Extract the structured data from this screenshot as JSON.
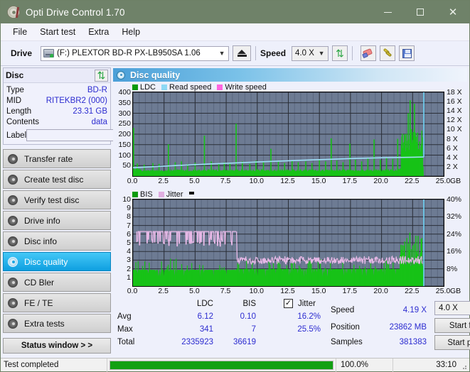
{
  "titlebar": {
    "title": "Opti Drive Control 1.70",
    "minimize": "–",
    "maximize": "",
    "close": "✕",
    "icon": "disc-icon"
  },
  "menubar": {
    "items": [
      {
        "label": "File"
      },
      {
        "label": "Start test"
      },
      {
        "label": "Extra"
      },
      {
        "label": "Help"
      }
    ]
  },
  "toolbar": {
    "drive_label": "Drive",
    "drive_value": "(F:)  PLEXTOR BD-R  PX-LB950SA 1.06",
    "eject_icon": "eject-icon",
    "speed_label": "Speed",
    "speed_value": "4.0 X",
    "refresh_icon": "refresh-icon",
    "erase_icon": "eraser-icon",
    "tools_icon": "tools-icon",
    "save_icon": "save-icon"
  },
  "sidebar": {
    "disc": {
      "title": "Disc",
      "refresh_icon": "refresh-icon",
      "rows": [
        {
          "key": "Type",
          "value": "BD-R"
        },
        {
          "key": "MID",
          "value": "RITEKBR2 (000)"
        },
        {
          "key": "Length",
          "value": "23.31 GB"
        },
        {
          "key": "Contents",
          "value": "data"
        }
      ],
      "label_key": "Label",
      "label_value": "",
      "label_placeholder": "",
      "disc_icon": "cd-icon"
    },
    "nav": [
      {
        "label": "Transfer rate",
        "active": false
      },
      {
        "label": "Create test disc",
        "active": false
      },
      {
        "label": "Verify test disc",
        "active": false
      },
      {
        "label": "Drive info",
        "active": false
      },
      {
        "label": "Disc info",
        "active": false
      },
      {
        "label": "Disc quality",
        "active": true
      },
      {
        "label": "CD Bler",
        "active": false
      },
      {
        "label": "FE / TE",
        "active": false
      },
      {
        "label": "Extra tests",
        "active": false
      }
    ],
    "status_window": "Status window > >"
  },
  "main": {
    "panel_title": "Disc quality",
    "panel_icon": "disc-quality-icon"
  },
  "stats": {
    "col_headers": [
      "LDC",
      "BIS"
    ],
    "row_labels": [
      "Avg",
      "Max",
      "Total"
    ],
    "ldc": {
      "avg": "6.12",
      "max": "341",
      "total": "2335923"
    },
    "bis": {
      "avg": "0.10",
      "max": "7",
      "total": "36619"
    },
    "jitter_label": "Jitter",
    "jitter_checked": true,
    "jitter_avg": "16.2%",
    "jitter_max": "25.5%",
    "speed_label": "Speed",
    "speed_value": "4.19 X",
    "position_label": "Position",
    "position_value": "23862 MB",
    "samples_label": "Samples",
    "samples_value": "381383",
    "speed_select": "4.0 X",
    "start_full": "Start full",
    "start_part": "Start part"
  },
  "statusbar": {
    "text": "Test completed",
    "progress_pct": "100.0%",
    "progress_value": 100,
    "time": "33:10"
  },
  "chart_data": [
    {
      "type": "area",
      "id": "ldc-chart",
      "title": "Disc quality",
      "legend": [
        {
          "name": "LDC",
          "color": "#0a9a0a"
        },
        {
          "name": "Read speed",
          "color": "#8fd9f5"
        },
        {
          "name": "Write speed",
          "color": "#ff66e0"
        }
      ],
      "legend_position": "top-left",
      "grid": true,
      "plot_bg": "#6d7b93",
      "xlabel": "GB",
      "xlim": [
        0,
        25
      ],
      "x_ticks": [
        "0.0",
        "2.5",
        "5.0",
        "7.5",
        "10.0",
        "12.5",
        "15.0",
        "17.5",
        "20.0",
        "22.5",
        "25.0"
      ],
      "ylabel_left": "LDC",
      "ylim_left": [
        0,
        400
      ],
      "y_ticks_left": [
        "400",
        "350",
        "300",
        "250",
        "200",
        "150",
        "100",
        "50"
      ],
      "ylabel_right": "Speed",
      "ylim_right": [
        0,
        18
      ],
      "y_ticks_right": [
        "18 X",
        "16 X",
        "14 X",
        "12 X",
        "10 X",
        "8 X",
        "6 X",
        "4 X",
        "2 X"
      ],
      "data_end_x": 23.4,
      "series": [
        {
          "name": "LDC",
          "color": "#0a9a0a",
          "baseline": 22,
          "noise": 12,
          "spikes": [
            [
              0.05,
              230
            ],
            [
              0.35,
              60
            ],
            [
              0.9,
              55
            ],
            [
              1.6,
              62
            ],
            [
              2.1,
              58
            ],
            [
              2.85,
              152
            ],
            [
              3.4,
              66
            ],
            [
              3.9,
              70
            ],
            [
              4.4,
              58
            ],
            [
              5.0,
              64
            ],
            [
              5.75,
              193
            ],
            [
              6.3,
              70
            ],
            [
              6.9,
              60
            ],
            [
              7.35,
              66
            ],
            [
              7.8,
              62
            ],
            [
              8.3,
              250
            ],
            [
              8.8,
              70
            ],
            [
              9.4,
              58
            ],
            [
              9.9,
              74
            ],
            [
              10.5,
              66
            ],
            [
              11.1,
              130
            ],
            [
              11.7,
              70
            ],
            [
              12.2,
              62
            ],
            [
              12.8,
              74
            ],
            [
              13.3,
              66
            ],
            [
              13.9,
              70
            ],
            [
              14.4,
              62
            ],
            [
              15.0,
              78
            ],
            [
              15.5,
              70
            ],
            [
              15.95,
              180
            ],
            [
              16.4,
              74
            ],
            [
              16.9,
              66
            ],
            [
              17.45,
              155
            ],
            [
              17.9,
              78
            ],
            [
              18.4,
              70
            ],
            [
              18.9,
              86
            ],
            [
              19.4,
              175
            ],
            [
              19.9,
              78
            ],
            [
              20.4,
              90
            ],
            [
              20.9,
              82
            ],
            [
              21.3,
              178
            ],
            [
              21.6,
              120
            ],
            [
              21.85,
              200
            ],
            [
              22.0,
              118
            ],
            [
              22.15,
              300
            ],
            [
              22.3,
              362
            ],
            [
              22.45,
              160
            ],
            [
              22.55,
              210
            ],
            [
              22.65,
              345
            ],
            [
              22.78,
              150
            ],
            [
              22.9,
              120
            ],
            [
              23.05,
              165
            ],
            [
              23.2,
              110
            ],
            [
              23.3,
              95
            ]
          ]
        },
        {
          "name": "Read speed",
          "color": "#8fd9f5",
          "points": [
            [
              0.0,
              1.8
            ],
            [
              1.5,
              2.0
            ],
            [
              3.0,
              2.2
            ],
            [
              4.6,
              2.4
            ],
            [
              6.2,
              2.6
            ],
            [
              8.0,
              2.8
            ],
            [
              9.8,
              3.0
            ],
            [
              11.6,
              3.2
            ],
            [
              13.6,
              3.4
            ],
            [
              15.8,
              3.6
            ],
            [
              18.0,
              3.8
            ],
            [
              20.4,
              3.95
            ],
            [
              22.6,
              4.05
            ],
            [
              23.4,
              4.1
            ]
          ],
          "vertical_end": {
            "x": 23.4,
            "from": 4.1,
            "to": 18
          }
        }
      ]
    },
    {
      "type": "area",
      "id": "bis-jitter-chart",
      "legend": [
        {
          "name": "BIS",
          "color": "#0a9a0a"
        },
        {
          "name": "Jitter",
          "color": "#e0aee0"
        }
      ],
      "legend_position": "top-left",
      "grid": true,
      "plot_bg": "#6d7b93",
      "xlabel": "GB",
      "xlim": [
        0,
        25
      ],
      "x_ticks": [
        "0.0",
        "2.5",
        "5.0",
        "7.5",
        "10.0",
        "12.5",
        "15.0",
        "17.5",
        "20.0",
        "22.5",
        "25.0"
      ],
      "ylabel_left": "BIS",
      "ylim_left": [
        0,
        10
      ],
      "y_ticks_left": [
        "10",
        "9",
        "8",
        "7",
        "6",
        "5",
        "4",
        "3",
        "2",
        "1"
      ],
      "ylabel_right": "Jitter",
      "ylim_right": [
        0,
        40
      ],
      "y_ticks_right": [
        "40%",
        "32%",
        "24%",
        "16%",
        "8%"
      ],
      "data_end_x": 23.4,
      "series": [
        {
          "name": "BIS",
          "color": "#0a9a0a",
          "baseline_before_8_3": 1.85,
          "baseline_after_8_3": 1.95,
          "spike_max": 3.2
        },
        {
          "name": "Jitter",
          "color": "#e0aee0",
          "segment1": {
            "x_range": [
              0.3,
              8.3
            ],
            "level": 6.3,
            "dips_to": 4.7
          },
          "segment2": {
            "x_range": [
              8.4,
              23.3
            ],
            "level": 3.0,
            "band": 0.45
          }
        },
        {
          "name": "end-marker",
          "color": "#8fd9f5",
          "vertical_line_x": 23.4
        }
      ]
    }
  ]
}
